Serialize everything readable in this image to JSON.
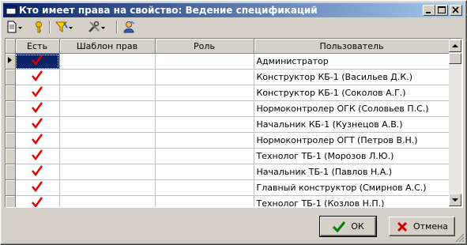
{
  "window": {
    "title": "Кто имеет права на свойство: Ведение спецификаций"
  },
  "toolbar": {
    "icons": [
      "new-document-icon",
      "key-icon",
      "filter-icon",
      "tools-icon",
      "user-icon"
    ]
  },
  "grid": {
    "columns": [
      "Есть",
      "Шаблон прав",
      "Роль",
      "Пользователь"
    ],
    "rows": [
      {
        "has": true,
        "template": "",
        "role": "",
        "user": "Администратор"
      },
      {
        "has": true,
        "template": "",
        "role": "",
        "user": "Конструктор КБ-1 (Васильев Д.К.)"
      },
      {
        "has": true,
        "template": "",
        "role": "",
        "user": "Конструктор КБ-1 (Соколов А.Г.)"
      },
      {
        "has": true,
        "template": "",
        "role": "",
        "user": "Нормоконтролер ОГК (Соловьев П.С.)"
      },
      {
        "has": true,
        "template": "",
        "role": "",
        "user": "Начальник КБ-1 (Кузнецов А.В.)"
      },
      {
        "has": true,
        "template": "",
        "role": "",
        "user": "Нормоконтролер ОГТ (Петров В.Н.)"
      },
      {
        "has": true,
        "template": "",
        "role": "",
        "user": "Технолог ТБ-1 (Морозов Л.Ю.)"
      },
      {
        "has": true,
        "template": "",
        "role": "",
        "user": "Начальник ТБ-1 (Павлов Н.А.)"
      },
      {
        "has": true,
        "template": "",
        "role": "",
        "user": "Главный конструктор (Смирнов А.С.)"
      },
      {
        "has": true,
        "template": "",
        "role": "",
        "user": "Технолог ТБ-1 (Козлов Н.П.)"
      }
    ]
  },
  "buttons": {
    "ok": "ОК",
    "cancel": "Отмена"
  },
  "colors": {
    "titlebar_start": "#0a246a",
    "titlebar_end": "#a6caf0",
    "check": "#e00000",
    "selected_cell": "#0a246a"
  }
}
